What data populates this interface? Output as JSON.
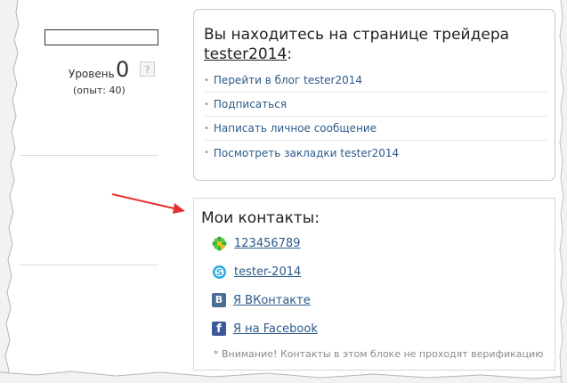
{
  "sidebar": {
    "level_label": "Уровень",
    "level_value": "0",
    "help_label": "?",
    "experience_label": "(опыт: 40)"
  },
  "trader": {
    "title_prefix": "Вы находитесь на странице трейдера",
    "username": "tester2014",
    "title_suffix": ":",
    "bullet": "•",
    "actions": [
      {
        "label": "Перейти в блог tester2014"
      },
      {
        "label": "Подписаться"
      },
      {
        "label": "Написать личное сообщение"
      },
      {
        "label": "Посмотреть закладки tester2014"
      }
    ]
  },
  "contacts": {
    "title": "Мои контакты:",
    "items": [
      {
        "icon": "icq-flower-icon",
        "label": "123456789"
      },
      {
        "icon": "skype-icon",
        "label": "tester-2014"
      },
      {
        "icon": "vk-icon",
        "icon_text": "В",
        "label": "Я ВКонтакте"
      },
      {
        "icon": "facebook-icon",
        "icon_text": "f",
        "label": "Я на Facebook"
      }
    ],
    "note": "* Внимание! Контакты в этом блоке не проходят верификацию"
  },
  "colors": {
    "link": "#2b5a8a",
    "arrow": "#e53030",
    "icq": "#39b02f",
    "skype": "#29a9e0",
    "vk": "#4a6d96",
    "facebook": "#3b5998"
  }
}
